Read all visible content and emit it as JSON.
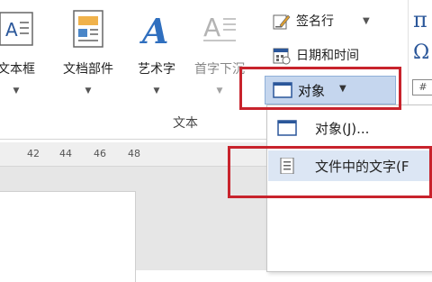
{
  "ribbon": {
    "big_buttons": [
      {
        "label": "文本框",
        "icon": "text-box-icon"
      },
      {
        "label": "文档部件",
        "icon": "quick-parts-icon"
      },
      {
        "label": "艺术字",
        "icon": "wordart-icon"
      },
      {
        "label": "首字下沉",
        "icon": "drop-cap-icon"
      }
    ],
    "small_buttons": {
      "signature_line": {
        "label": "签名行",
        "icon": "signature-line-icon"
      },
      "date_time": {
        "label": "日期和时间",
        "icon": "date-time-icon"
      },
      "object": {
        "label": "对象",
        "icon": "object-icon"
      }
    },
    "group_label": "文本",
    "right_symbols": {
      "pi": "π",
      "omega": "Ω",
      "equation": "#"
    }
  },
  "ruler": {
    "ticks": [
      "42",
      "44",
      "46",
      "48"
    ]
  },
  "object_menu": {
    "items": [
      {
        "label": "对象(J)...",
        "icon": "object-icon"
      },
      {
        "label": "文件中的文字(F",
        "icon": "text-from-file-icon"
      }
    ]
  },
  "colors": {
    "highlight": "#c8232c",
    "hover": "#dce6f4",
    "accent": "#2b579a"
  }
}
